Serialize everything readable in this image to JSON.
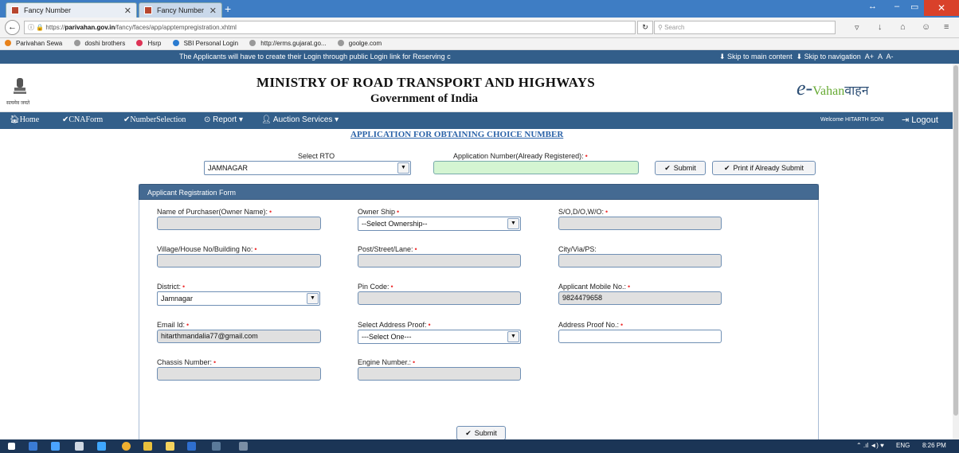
{
  "browser": {
    "tabs": [
      {
        "label": "Fancy Number"
      },
      {
        "label": "Fancy Number"
      }
    ],
    "url_prefix": "https://",
    "url_host": "parivahan.gov.in",
    "url_path": "/fancy/faces/app/apptempregistration.xhtml",
    "search_placeholder": "Search",
    "bookmarks": [
      "Parivahan Sewa",
      "doshi brothers",
      "Hsrp",
      "SBI Personal Login",
      "http://erms.gujarat.go...",
      "goolge.com"
    ]
  },
  "announcement": {
    "message": "The Applicants will have to create their Login through public Login link for Reserving c",
    "skip_main": "Skip to main content",
    "skip_nav": "Skip to navigation",
    "font_sizes": [
      "A+",
      "A",
      "A-"
    ]
  },
  "header": {
    "emblem_caption": "सत्यमेव जयते",
    "ministry": "MINISTRY OF ROAD TRANSPORT AND HIGHWAYS",
    "government": "Government of India",
    "logo_e": "e-",
    "logo_vahan": "Vahan",
    "logo_hindi": "वाहन"
  },
  "menu": {
    "home": "Home",
    "cnaform": "CNAForm",
    "numberselection": "NumberSelection",
    "report": "Report",
    "auction": "Auction Services",
    "welcome": "Welcome HITARTH SONI",
    "logout": "Logout"
  },
  "page": {
    "title": "APPLICATION FOR OBTAINING CHOICE NUMBER",
    "select_rto_label": "Select RTO",
    "select_rto_value": "JAMNAGAR",
    "app_number_label": "Application Number(Already Registered):",
    "submit": "Submit",
    "print_submit": "Print if Already Submit"
  },
  "form": {
    "heading": "Applicant Registration Form",
    "owner_name_label": "Name of Purchaser(Owner Name):",
    "ownership_label": "Owner Ship",
    "ownership_value": "--Select Ownership--",
    "sdw_label": "S/O,D/O,W/O:",
    "village_label": "Village/House No/Building No:",
    "post_label": "Post/Street/Lane:",
    "city_label": "City/Via/PS:",
    "district_label": "District:",
    "district_value": "Jamnagar",
    "pin_label": "Pin Code:",
    "mobile_label": "Applicant Mobile No.:",
    "mobile_value": "9824479658",
    "email_label": "Email Id:",
    "email_value": "hitarthmandalia77@gmail.com",
    "address_proof_label": "Select Address Proof:",
    "address_proof_value": "---Select One---",
    "address_proof_no_label": "Address Proof No.:",
    "chassis_label": "Chassis Number:",
    "engine_label": "Engine Number.:",
    "submit": "Submit"
  },
  "taskbar": {
    "lang": "ENG",
    "time": "8:26 PM"
  },
  "colors": {
    "menu": "#335f8a",
    "panel_head": "#446a92",
    "title": "#2a62a8",
    "required": "#ee3333"
  }
}
